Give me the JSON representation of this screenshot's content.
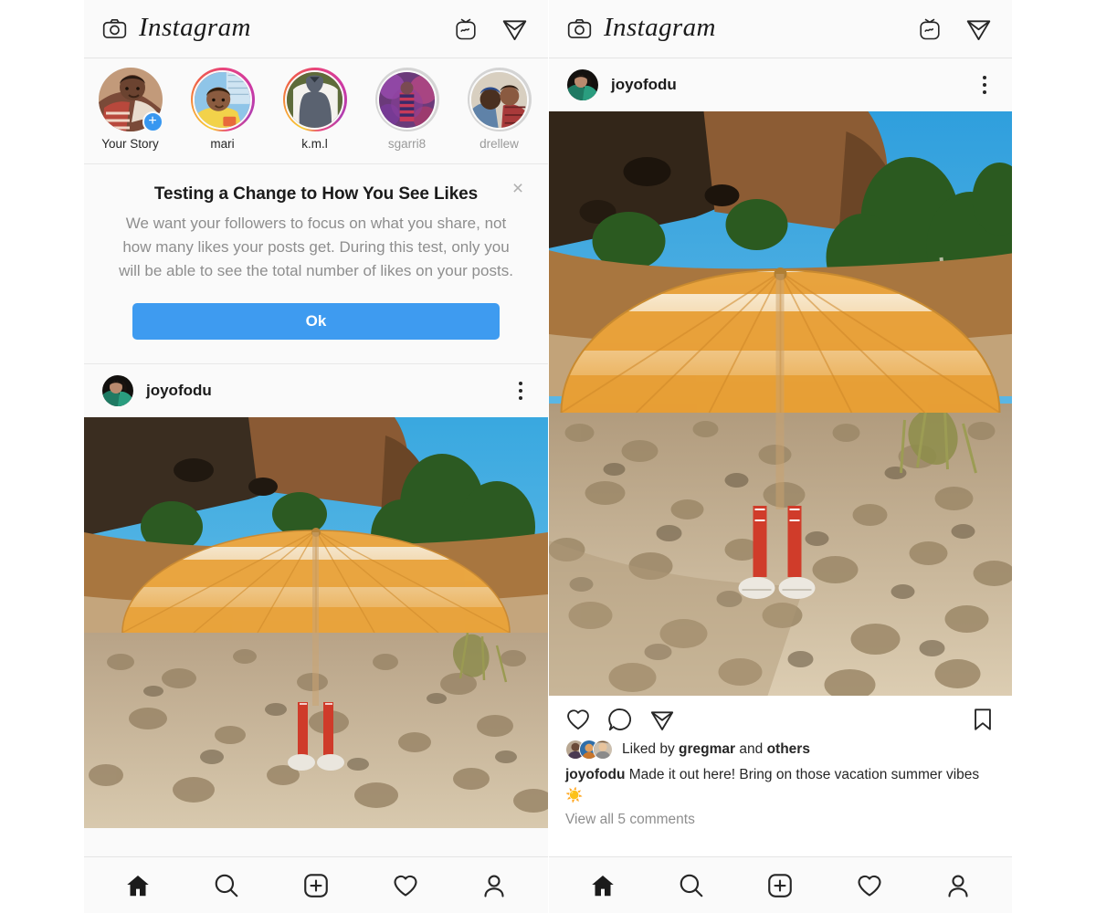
{
  "app": {
    "brand": "Instagram",
    "accent_blue": "#3e9bf0",
    "panel_bg": "#fafafa",
    "text_primary": "#262626",
    "text_muted": "#8e8e8e",
    "story_ring_gradient": [
      "#f9ce34",
      "#ee2a7b",
      "#6228d7"
    ],
    "story_ring_seen": "#d4d4d4"
  },
  "topbar": {
    "camera_icon": "camera-icon",
    "igtv_icon": "igtv-icon",
    "direct_icon": "paper-plane-icon"
  },
  "stories": [
    {
      "name": "Your Story",
      "ring": "none",
      "muted": false,
      "has_add_badge": true,
      "add_badge_label": "+"
    },
    {
      "name": "mari",
      "ring": "active",
      "muted": false,
      "has_add_badge": false,
      "add_badge_label": ""
    },
    {
      "name": "k.m.l",
      "ring": "active",
      "muted": false,
      "has_add_badge": false,
      "add_badge_label": ""
    },
    {
      "name": "sgarri8",
      "ring": "seen",
      "muted": true,
      "has_add_badge": false,
      "add_badge_label": ""
    },
    {
      "name": "drellew",
      "ring": "seen",
      "muted": true,
      "has_add_badge": false,
      "add_badge_label": ""
    }
  ],
  "notice": {
    "title": "Testing a Change to How You See Likes",
    "body": "We want your followers to focus on what you share, not how many likes your posts get. During this test, only you will be able to see the total number of likes on your posts.",
    "close_label": "×",
    "button_label": "Ok"
  },
  "post": {
    "username": "joyofodu",
    "menu_icon": "more-options-icon",
    "like_icon": "heart-icon",
    "comment_icon": "comment-bubble-icon",
    "share_icon": "paper-plane-icon",
    "save_icon": "bookmark-icon",
    "liked_by_prefix": "Liked by ",
    "liked_by_user": "gregmar",
    "liked_by_middle": " and ",
    "liked_by_others": "others",
    "caption_user": "joyofodu",
    "caption_text": " Made it out here! Bring on those vacation summer vibes ☀️",
    "view_comments": "View all 5 comments"
  },
  "bottomnav": [
    {
      "icon": "home-icon",
      "label": "Home",
      "active": true
    },
    {
      "icon": "search-icon",
      "label": "Search",
      "active": false
    },
    {
      "icon": "add-post-icon",
      "label": "New Post",
      "active": false
    },
    {
      "icon": "heart-icon",
      "label": "Activity",
      "active": false
    },
    {
      "icon": "profile-icon",
      "label": "Profile",
      "active": false
    }
  ]
}
